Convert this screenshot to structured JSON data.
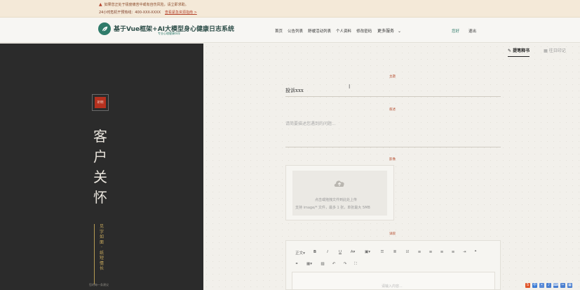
{
  "alert": {
    "warning_text": "如果您正处于极度痛苦中或有自伤风险，请立即求助。",
    "hotline": "24小时危机干预热线：400-XXX-XXXX",
    "link_text": "查看紧急资源指南 >"
  },
  "navbar": {
    "brand_title": "基于Vue框架+AI大模型身心健康日志系统",
    "brand_subtitle": "专业心理健康伙伴",
    "links": [
      "首页",
      "公告列表",
      "舒缓活动列表",
      "个人资料",
      "修改密码"
    ],
    "more": "更多服务",
    "hello": "您好",
    "logout": "退出"
  },
  "sidebar": {
    "seal": "祈明",
    "title_chars": [
      "客",
      "户",
      "关",
      "怀"
    ],
    "poem_chars": [
      "见",
      "字",
      "如",
      "面",
      "·",
      "纸",
      "短",
      "情",
      "长"
    ],
    "footer": "您的每一条建议"
  },
  "tabs": [
    {
      "label": "提笔释书",
      "active": true
    },
    {
      "label": "往日印记",
      "active": false
    }
  ],
  "form": {
    "subject_label": "主题",
    "subject_value": "投诉xxx",
    "desc_label": "叙述",
    "desc_placeholder": "请简要描述您遇到的问题...",
    "image_label": "影像",
    "upload_text": "点击或拖拽文件到此处上传",
    "upload_hint": "支持 image/* 文件，最多 1 张，单张最大 5MB",
    "detail_label": "详叙",
    "editor_format": "正文",
    "editor_placeholder": "请输入内容..."
  }
}
